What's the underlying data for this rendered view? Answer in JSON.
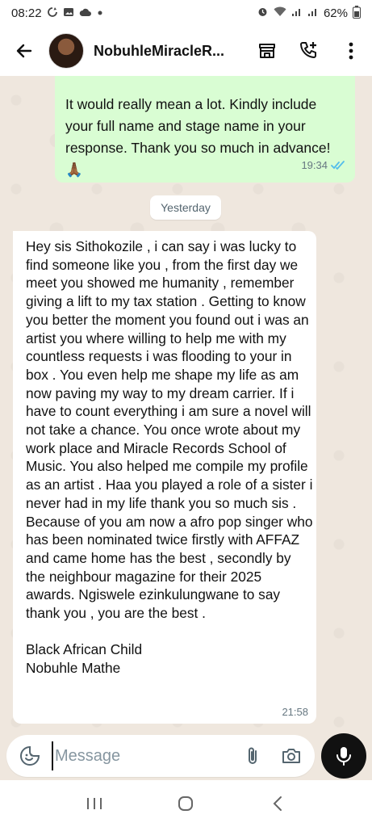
{
  "status_bar": {
    "time": "08:22",
    "battery": "62%",
    "left_icons": [
      "sync-icon",
      "gallery-icon",
      "cloud-icon",
      "dot-icon"
    ],
    "right_icons": [
      "alarm-icon",
      "wifi-icon",
      "signal-icon",
      "signal-icon",
      "battery-icon"
    ]
  },
  "header": {
    "contact_name": "NobuhleMiracleR...",
    "icons": [
      "back-arrow-icon",
      "storefront-icon",
      "add-call-icon",
      "more-vert-icon"
    ]
  },
  "chat": {
    "outgoing": {
      "text": "It would really mean a lot. Kindly include your full name and stage name in your response. Thank you so much in advance!",
      "emoji": "🙏🏾",
      "time": "19:34",
      "status": "read"
    },
    "date_separator": "Yesterday",
    "incoming": {
      "text": "Hey sis Sithokozile , i can say i was lucky to find someone like you , from the first day we meet you showed me humanity , remember giving a lift to my tax station . Getting to know you better the moment you found out i was an artist you where willing to help me with my countless requests i was flooding to your in box . You even help me shape my life as am now paving my way to my dream carrier. If i have to count everything i am sure a novel will not take a chance. You once wrote about my work place and Miracle Records School of Music. You also helped me compile my profile as an artist . Haa you played a role of a sister i never had in my life thank you so much sis . Because of you am now a afro pop singer who has been nominated twice firstly with AFFAZ and came home has the best , secondly by the neighbour magazine for their 2025 awards. Ngiswele ezinkulungwane to say thank you , you are the best .\n\nBlack African Child\nNobuhle Mathe",
      "time": "21:58"
    }
  },
  "composer": {
    "placeholder": "Message",
    "value": ""
  },
  "colors": {
    "outgoing_bubble": "#d9fdd3",
    "incoming_bubble": "#ffffff",
    "chat_background": "#efe7de",
    "read_ticks": "#53bdeb",
    "mic_button": "#111111"
  }
}
